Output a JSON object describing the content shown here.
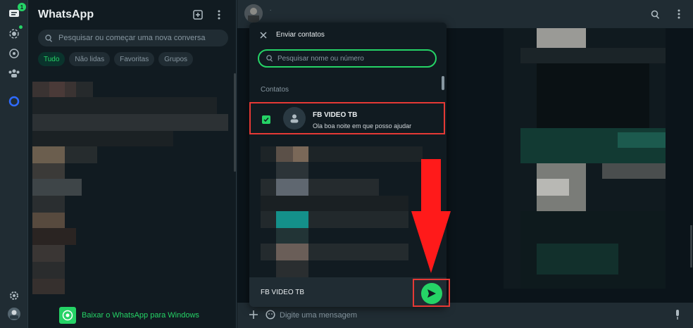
{
  "rail": {
    "chats_badge": "1"
  },
  "chat_list": {
    "title": "WhatsApp",
    "search_placeholder": "Pesquisar ou começar uma nova conversa",
    "filters": [
      {
        "label": "Tudo",
        "active": true
      },
      {
        "label": "Não lidas",
        "active": false
      },
      {
        "label": "Favoritas",
        "active": false
      },
      {
        "label": "Grupos",
        "active": false
      }
    ],
    "download_text": "Baixar o WhatsApp para Windows"
  },
  "conversation": {
    "header_text": ".",
    "composer_placeholder": "Digite uma mensagem"
  },
  "modal": {
    "title": "Enviar contatos",
    "search_placeholder": "Pesquisar nome ou número",
    "section_label": "Contatos",
    "selected_contact": {
      "name": "FB VIDEO TB",
      "status": "Ola boa noite em que posso ajudar",
      "checked": true
    },
    "footer_selected": "FB VIDEO TB"
  },
  "colors": {
    "accent": "#25d366",
    "annotation": "#e53935",
    "background": "#111b21",
    "panel": "#202c33"
  }
}
